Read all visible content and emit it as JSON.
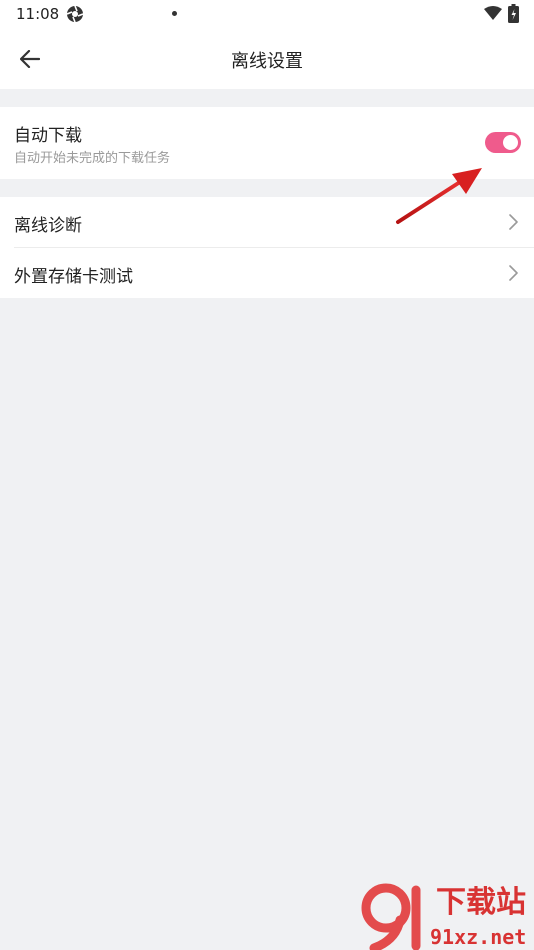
{
  "status_bar": {
    "time": "11:08"
  },
  "header": {
    "title": "离线设置"
  },
  "auto_download": {
    "title": "自动下载",
    "description": "自动开始未完成的下载任务",
    "enabled": true
  },
  "list": {
    "items": [
      {
        "label": "离线诊断"
      },
      {
        "label": "外置存储卡测试"
      }
    ]
  },
  "watermark": {
    "text_top": "下载站",
    "text_bottom": "91xz.net"
  },
  "colors": {
    "accent": "#ef5b8c",
    "background": "#f0f1f3",
    "annotation": "#d82020"
  }
}
